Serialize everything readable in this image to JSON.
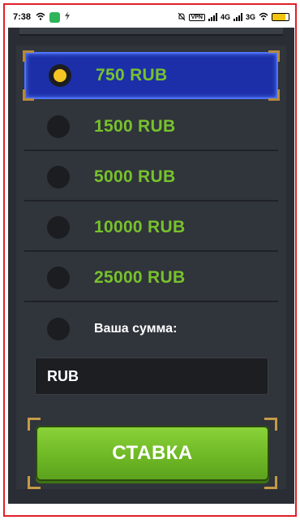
{
  "status_bar": {
    "time": "7:38",
    "vpn": "VPN",
    "net1": "4G",
    "net2": "3G"
  },
  "bet_options": [
    {
      "label": "750 RUB",
      "selected": true
    },
    {
      "label": "1500 RUB",
      "selected": false
    },
    {
      "label": "5000 RUB",
      "selected": false
    },
    {
      "label": "10000 RUB",
      "selected": false
    },
    {
      "label": "25000 RUB",
      "selected": false
    }
  ],
  "custom_amount": {
    "label": "Ваша сумма:",
    "placeholder": "RUB"
  },
  "bet_button": {
    "label": "СТАВКА"
  },
  "colors": {
    "accent_green": "#77c22d",
    "selected_bg": "#1c2fa8",
    "radio_dot": "#f5c623",
    "frame_red": "#e0202a"
  }
}
